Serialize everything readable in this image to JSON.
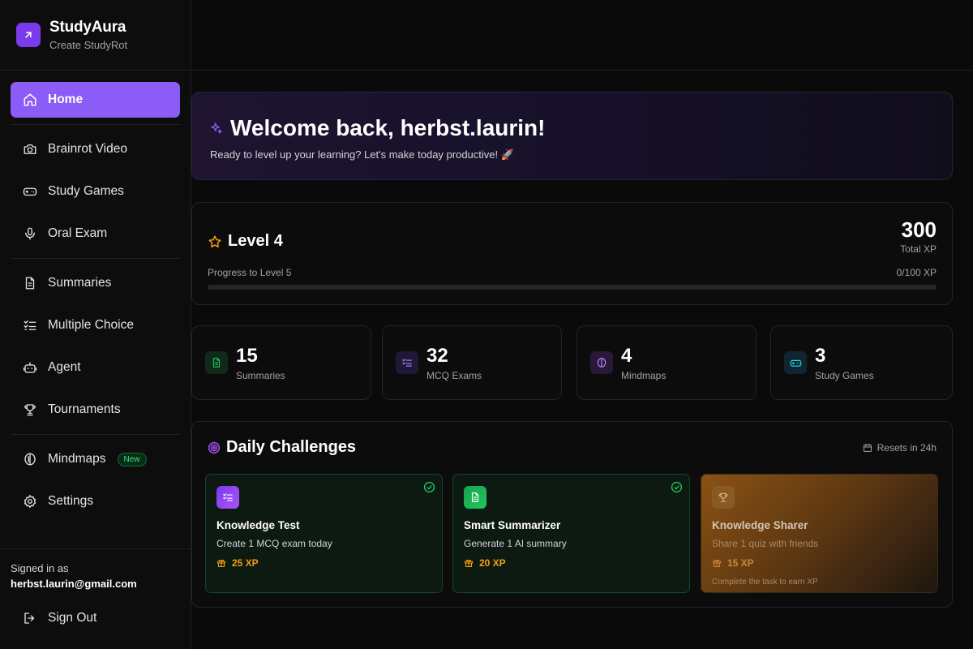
{
  "brand": {
    "title": "StudyAura",
    "subtitle": "Create StudyRot"
  },
  "nav": {
    "home": "Home",
    "brainrot_video": "Brainrot Video",
    "study_games": "Study Games",
    "oral_exam": "Oral Exam",
    "summaries": "Summaries",
    "multiple_choice": "Multiple Choice",
    "agent": "Agent",
    "tournaments": "Tournaments",
    "mindmaps": "Mindmaps",
    "mindmaps_badge": "New",
    "settings": "Settings"
  },
  "account": {
    "signed_in_label": "Signed in as",
    "email": "herbst.laurin@gmail.com",
    "sign_out": "Sign Out"
  },
  "welcome": {
    "title": "Welcome back, herbst.laurin!",
    "subtitle": "Ready to level up your learning? Let's make today productive! 🚀"
  },
  "level": {
    "title": "Level 4",
    "total_xp": "300",
    "total_xp_label": "Total XP",
    "progress_label": "Progress to Level 5",
    "progress_text": "0/100 XP",
    "progress_fraction": 0
  },
  "stats": [
    {
      "value": "15",
      "label": "Summaries"
    },
    {
      "value": "32",
      "label": "MCQ Exams"
    },
    {
      "value": "4",
      "label": "Mindmaps"
    },
    {
      "value": "3",
      "label": "Study Games"
    }
  ],
  "daily": {
    "title": "Daily Challenges",
    "resets": "Resets in 24h",
    "challenges": [
      {
        "title": "Knowledge Test",
        "desc": "Create 1 MCQ exam today",
        "xp": "25 XP"
      },
      {
        "title": "Smart Summarizer",
        "desc": "Generate 1 AI summary",
        "xp": "20 XP"
      },
      {
        "title": "Knowledge Sharer",
        "desc": "Share 1 quiz with friends",
        "xp": "15 XP",
        "note": "Complete the task to earn XP"
      }
    ]
  },
  "colors": {
    "accent": "#8b5cf6",
    "success": "#22c55e",
    "xp": "#f59e0b",
    "background": "#0a0a0b"
  }
}
